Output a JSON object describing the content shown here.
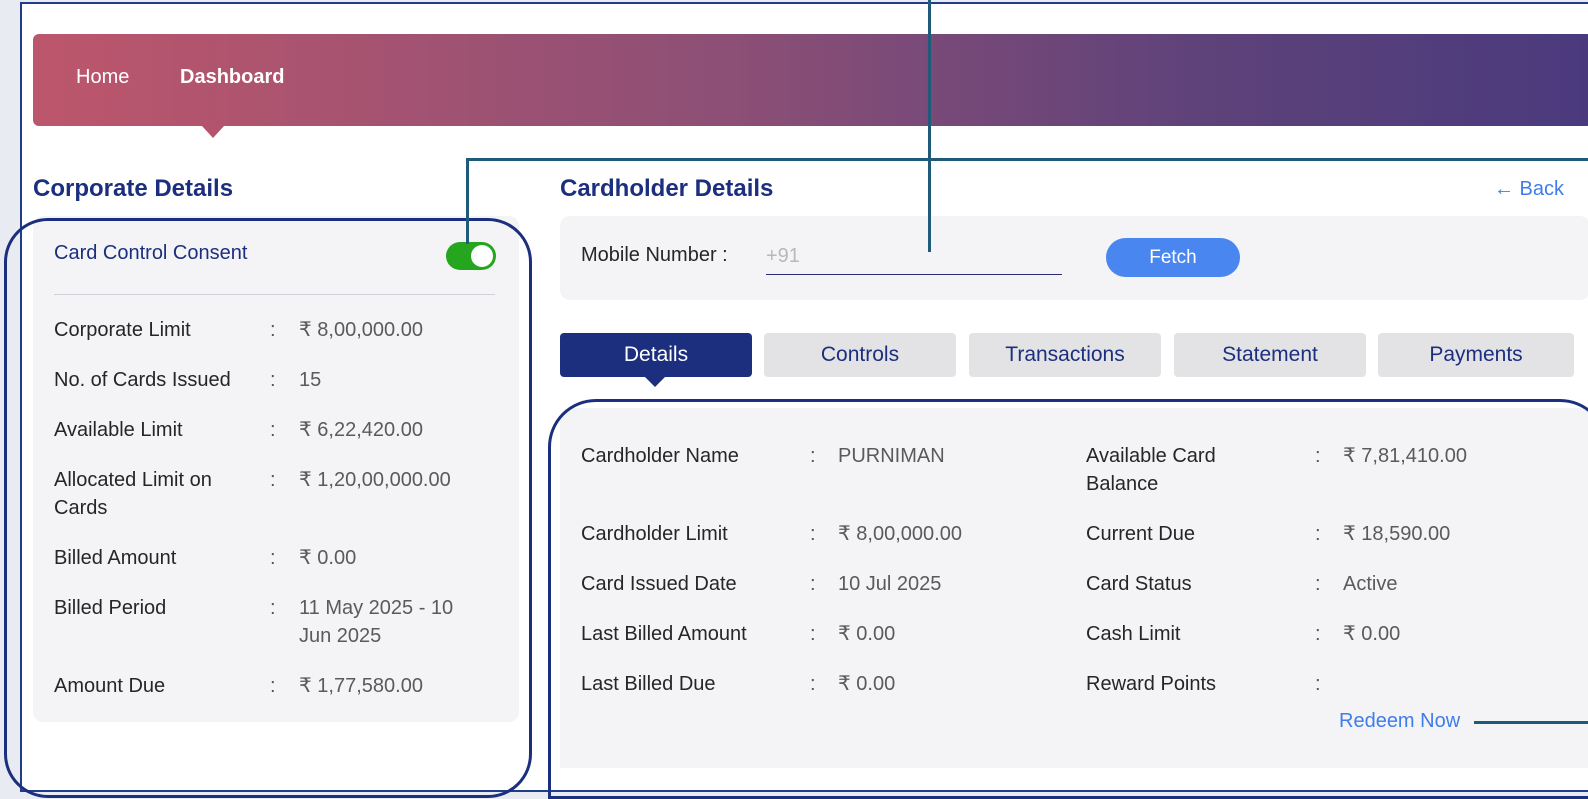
{
  "nav": {
    "home": "Home",
    "dashboard": "Dashboard"
  },
  "corporate": {
    "title": "Corporate Details",
    "consent_label": "Card Control Consent",
    "consent_enabled": true,
    "rows": [
      {
        "label": "Corporate Limit",
        "value": "₹ 8,00,000.00"
      },
      {
        "label": "No. of Cards Issued",
        "value": "15"
      },
      {
        "label": "Available Limit",
        "value": "₹ 6,22,420.00"
      },
      {
        "label": "Allocated Limit on Cards",
        "value": "₹ 1,20,00,000.00"
      },
      {
        "label": "Billed Amount",
        "value": "₹ 0.00"
      },
      {
        "label": "Billed Period",
        "value": "11 May 2025 - 10 Jun 2025"
      },
      {
        "label": "Amount Due",
        "value": "₹ 1,77,580.00"
      }
    ]
  },
  "cardholder": {
    "title": "Cardholder Details",
    "back_label": "← Back",
    "mobile_label": "Mobile Number :",
    "mobile_placeholder": "+91",
    "mobile_value": "",
    "fetch_label": "Fetch",
    "tabs": [
      "Details",
      "Controls",
      "Transactions",
      "Statement",
      "Payments"
    ],
    "active_tab": "Details",
    "left_rows": [
      {
        "label": "Cardholder Name",
        "value": "PURNIMAN"
      },
      {
        "label": "Cardholder Limit",
        "value": "₹ 8,00,000.00"
      },
      {
        "label": "Card Issued Date",
        "value": "10 Jul 2025"
      },
      {
        "label": "Last Billed Amount",
        "value": "₹ 0.00"
      },
      {
        "label": "Last Billed Due",
        "value": "₹ 0.00"
      }
    ],
    "right_rows": [
      {
        "label": "Available Card Balance",
        "value": "₹ 7,81,410.00"
      },
      {
        "label": "Current Due",
        "value": "₹ 18,590.00"
      },
      {
        "label": "Card Status",
        "value": "Active"
      },
      {
        "label": "Cash Limit",
        "value": "₹ 0.00"
      },
      {
        "label": "Reward Points",
        "value": ""
      }
    ],
    "redeem_label": "Redeem Now"
  },
  "colors": {
    "brand_navy": "#1c2f7e",
    "link_blue": "#3f7de8",
    "toggle_green": "#25a61e"
  }
}
